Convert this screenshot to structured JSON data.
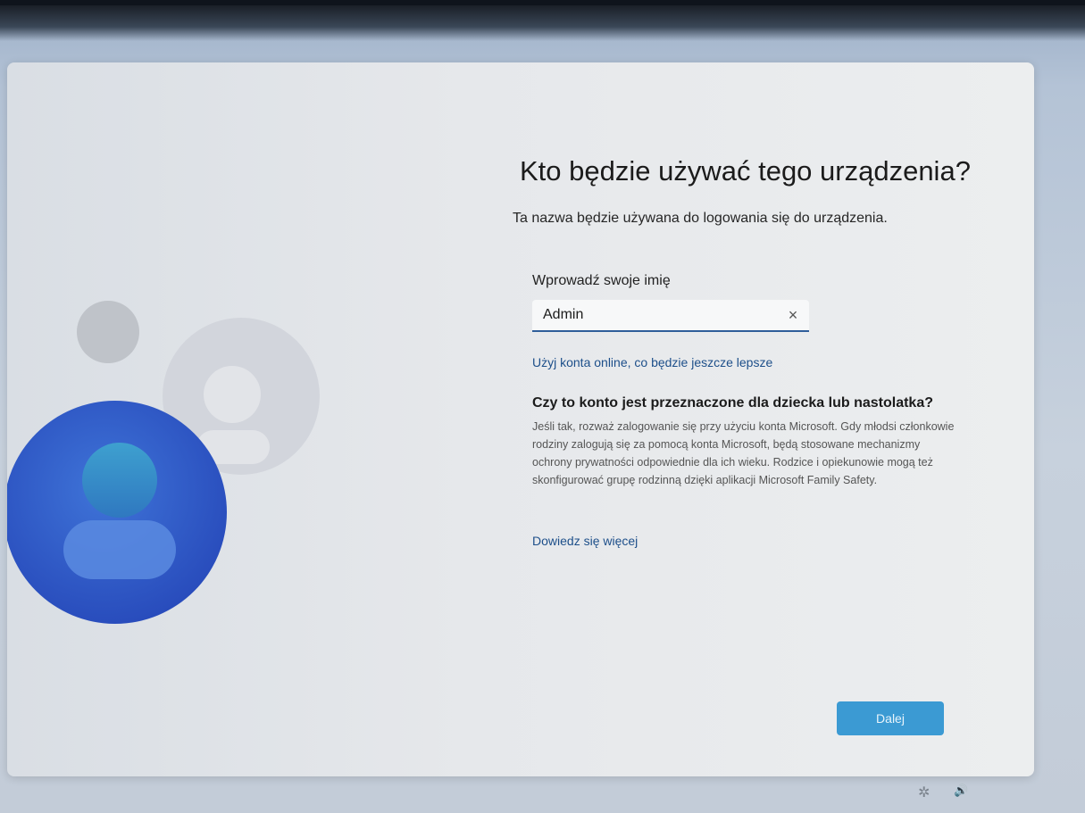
{
  "page": {
    "title": "Kto będzie używać tego urządzenia?",
    "subtitle": "Ta nazwa będzie używana do logowania się do urządzenia."
  },
  "name_field": {
    "label": "Wprowadź swoje imię",
    "value": "Admin",
    "clear_icon": "×"
  },
  "online_account_link": "Użyj konta online, co będzie jeszcze lepsze",
  "child_section": {
    "heading": "Czy to konto jest przeznaczone dla dziecka lub nastolatka?",
    "body": "Jeśli tak, rozważ zalogowanie się przy użyciu konta Microsoft. Gdy młodsi członkowie rodziny zalogują się za pomocą konta Microsoft, będą stosowane mechanizmy ochrony prywatności odpowiednie dla ich wieku. Rodzice i opiekunowie mogą też skonfigurować grupę rodzinną dzięki aplikacji Microsoft Family Safety.",
    "learn_more": "Dowiedz się więcej"
  },
  "next_button": "Dalej",
  "tray": {
    "accessibility_icon": "accessibility-icon",
    "accessibility_glyph": "✲",
    "volume_icon": "volume-icon",
    "volume_glyph": "🔊"
  },
  "colors": {
    "accent": "#3b9ad3",
    "link": "#1d4f8a",
    "avatar_blue": "#2f5bc8"
  }
}
